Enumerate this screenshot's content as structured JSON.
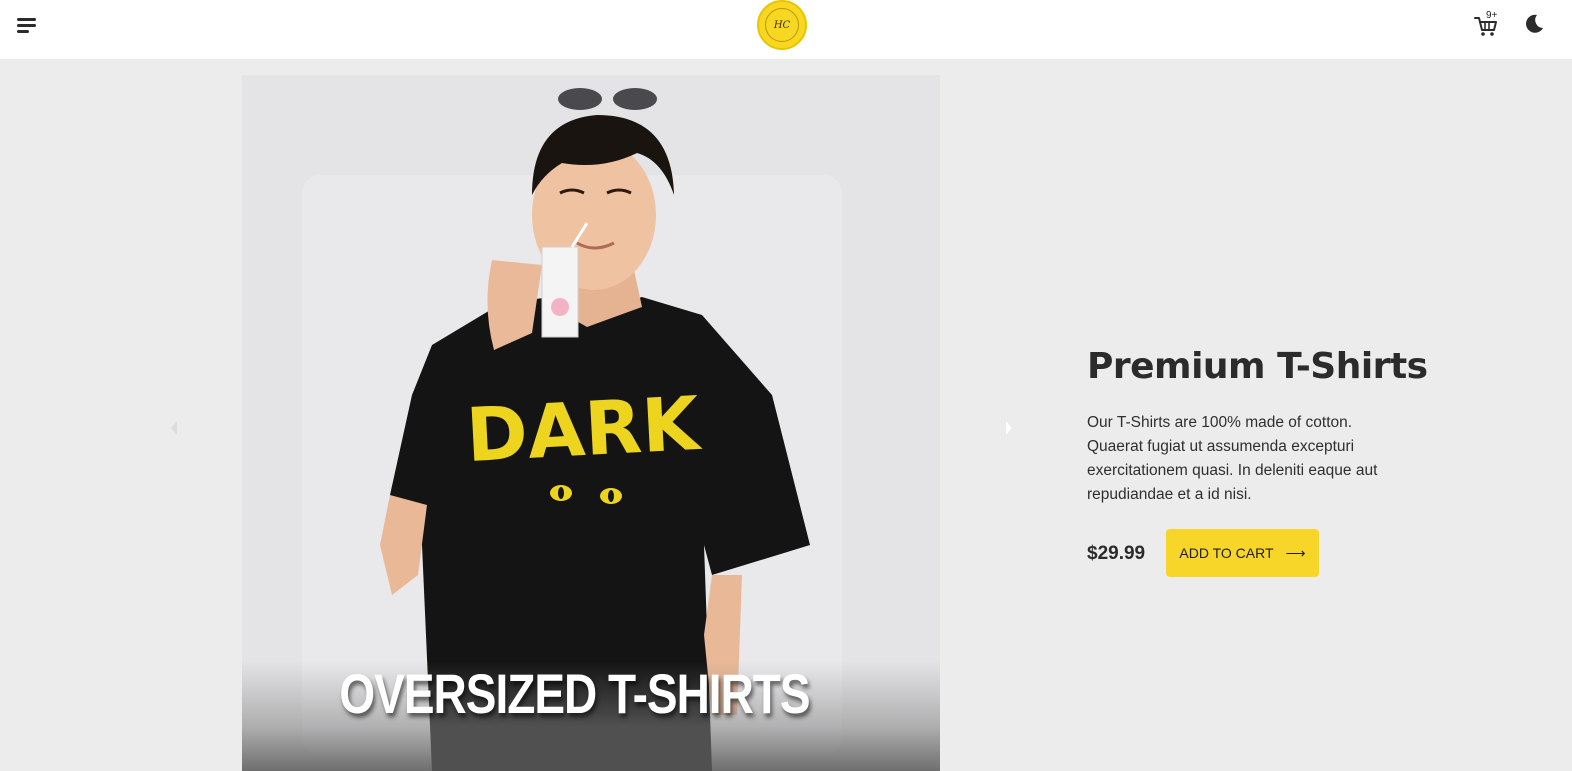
{
  "header": {
    "logo_text": "HC",
    "cart_badge": "9+"
  },
  "hero": {
    "caption": "OVERSIZED T-SHIRTS"
  },
  "product": {
    "title": "Premium T-Shirts",
    "description": "Our T-Shirts are 100% made of cotton. Quaerat fugiat ut assumenda excepturi exercitationem quasi. In deleniti eaque aut repudiandae et a id nisi.",
    "price": "$29.99",
    "add_to_cart_label": "ADD TO CART",
    "arrow": "⟶"
  },
  "colors": {
    "accent": "#f8d629",
    "background": "#ececec",
    "header": "#ffffff"
  },
  "icons": [
    "menu-icon",
    "logo",
    "cart-icon",
    "moon-icon",
    "chevron-left-icon",
    "chevron-right-icon",
    "arrow-right-icon"
  ]
}
